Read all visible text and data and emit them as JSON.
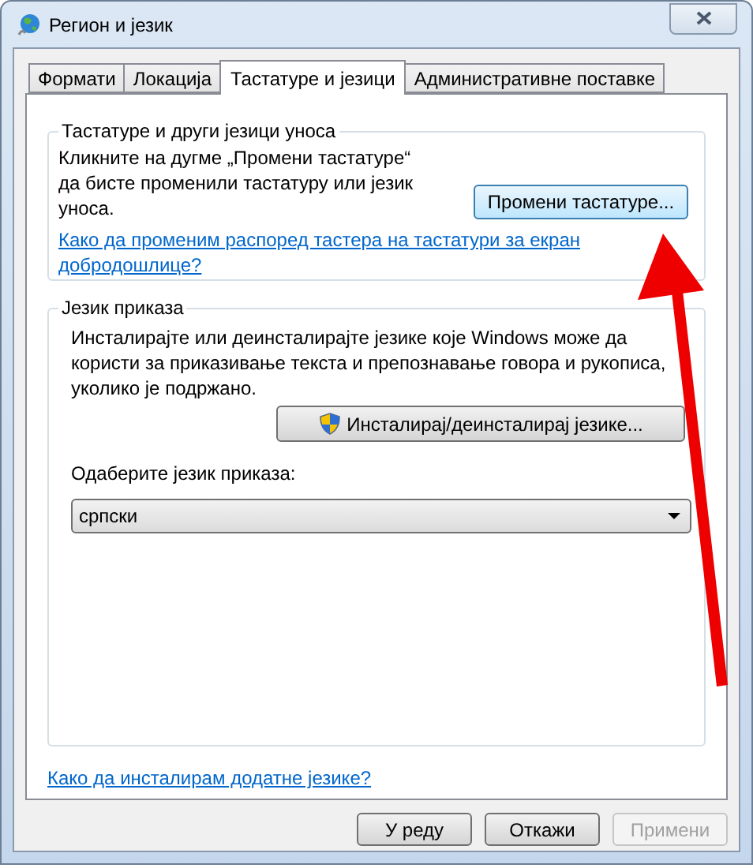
{
  "window": {
    "title": "Регион и језик"
  },
  "tabs": [
    {
      "label": "Формати",
      "selected": false
    },
    {
      "label": "Локација",
      "selected": false
    },
    {
      "label": "Тастатуре и језици",
      "selected": true
    },
    {
      "label": "Административне поставке",
      "selected": false
    }
  ],
  "keyboards_group": {
    "title": "Тастатуре и други језици уноса",
    "text": "Кликните на дугме „Промени тастатуре“ да бисте променили тастатуру или језик уноса.",
    "button": "Промени тастатуре...",
    "link": "Како да променим распоред тастера на тастатури за екран добродошлице?"
  },
  "display_group": {
    "title": "Језик приказа",
    "text": "Инсталирајте или деинсталирајте језике које Windows може да користи за приказивање текста и препознавање говора и рукописа, уколико је подржано.",
    "button": "Инсталирај/деинсталирај језике...",
    "select_label": "Одаберите језик приказа:",
    "select": {
      "value": "српски"
    }
  },
  "link": "Како да инсталирам додатне језике?",
  "buttons": [
    {
      "label": "У реду",
      "disabled": false
    },
    {
      "label": "Откажи",
      "disabled": false
    },
    {
      "label": "Примени",
      "disabled": true
    }
  ]
}
